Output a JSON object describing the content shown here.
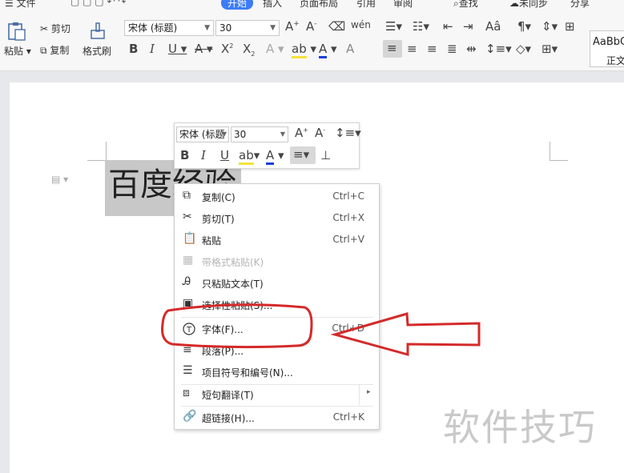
{
  "menu": {
    "tabs": [
      {
        "label": "文件"
      },
      {
        "label": "开始"
      },
      {
        "label": "插入"
      },
      {
        "label": "页面布局"
      },
      {
        "label": "引用"
      },
      {
        "label": "审阅"
      },
      {
        "label": "查找"
      },
      {
        "label": "未同步"
      },
      {
        "label": "分享"
      }
    ]
  },
  "ribbon": {
    "paste_label": "粘贴",
    "cut_label": "剪切",
    "copy_label": "复制",
    "format_painter_label": "格式刷",
    "font_name": "宋体 (标题)",
    "font_size": "30",
    "style_preview": "AaBbC",
    "style_name": "正文"
  },
  "document": {
    "heading_text": "百度经验"
  },
  "mini_toolbar": {
    "font_name": "宋体 (标题",
    "font_size": "30"
  },
  "context_menu": {
    "items": [
      {
        "label": "复制(C)",
        "shortcut": "Ctrl+C"
      },
      {
        "label": "剪切(T)",
        "shortcut": "Ctrl+X"
      },
      {
        "label": "粘贴",
        "shortcut": "Ctrl+V"
      },
      {
        "label": "带格式粘贴(K)",
        "shortcut": ""
      },
      {
        "label": "只粘贴文本(T)",
        "shortcut": ""
      },
      {
        "label": "选择性粘贴(S)...",
        "shortcut": ""
      },
      {
        "label": "字体(F)...",
        "shortcut": "Ctrl+D"
      },
      {
        "label": "段落(P)...",
        "shortcut": ""
      },
      {
        "label": "项目符号和编号(N)...",
        "shortcut": ""
      },
      {
        "label": "短句翻译(T)",
        "shortcut": ""
      },
      {
        "label": "超链接(H)...",
        "shortcut": "Ctrl+K"
      }
    ]
  },
  "watermark": {
    "text": "软件技巧"
  },
  "colors": {
    "annotation": "#d42a2a",
    "active_tab": "#3d7cf5",
    "font_color": "#1a3fd6",
    "highlight": "#f5e23b"
  }
}
